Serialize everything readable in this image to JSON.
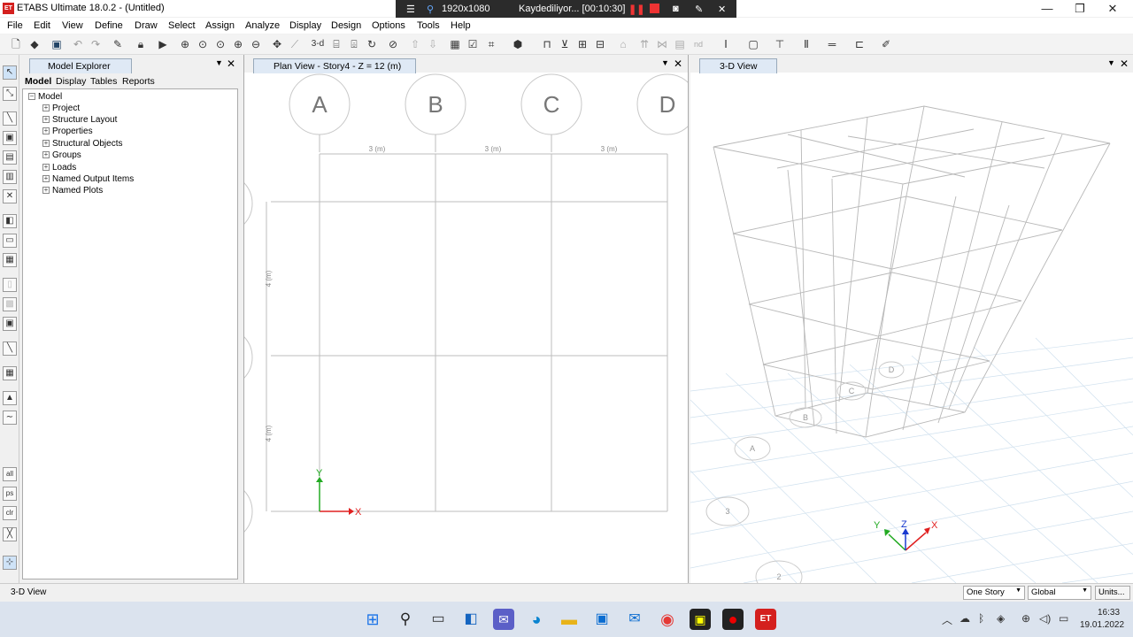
{
  "app": {
    "title": "ETABS Ultimate 18.0.2 - (Untitled)",
    "icon_text": "ET"
  },
  "recorder": {
    "resolution": "1920x1080",
    "status": "Kaydediliyor... [00:10:30]"
  },
  "menu": [
    "File",
    "Edit",
    "View",
    "Define",
    "Draw",
    "Select",
    "Assign",
    "Analyze",
    "Display",
    "Design",
    "Options",
    "Tools",
    "Help"
  ],
  "toolbar": {
    "view_3d_label": "3-d",
    "nd_label": "nd"
  },
  "explorer": {
    "title": "Model Explorer",
    "tabs": [
      "Model",
      "Display",
      "Tables",
      "Reports"
    ],
    "tree_root": "Model",
    "tree_items": [
      "Project",
      "Structure Layout",
      "Properties",
      "Structural Objects",
      "Groups",
      "Loads",
      "Named Output Items",
      "Named Plots"
    ]
  },
  "plan_view": {
    "title": "Plan View - Story4 - Z = 12 (m)",
    "grid_bubbles": [
      "A",
      "B",
      "C",
      "D"
    ],
    "x_dims": [
      "3 (m)",
      "3 (m)",
      "3 (m)"
    ],
    "y_dims": [
      "4 (m)",
      "4 (m)"
    ],
    "axis_x": "X",
    "axis_y": "Y"
  },
  "view_3d": {
    "title": "3-D View",
    "bubbles": [
      "A",
      "B",
      "C",
      "D",
      "3",
      "2"
    ],
    "axis_x": "X",
    "axis_y": "Y",
    "axis_z": "Z"
  },
  "left_tools": {
    "label_all": "all",
    "label_ps": "ps",
    "label_clr": "clr"
  },
  "status": {
    "text": "3-D View",
    "story_combo": "One Story",
    "coord_combo": "Global",
    "units_button": "Units..."
  },
  "taskbar": {
    "time": "16:33",
    "date": "19.01.2022"
  },
  "colors": {
    "accent": "#d4201e",
    "tab_active": "#dfe9f5",
    "axis_red": "#e02020",
    "axis_green": "#22aa22",
    "axis_blue": "#1a3ad0"
  }
}
